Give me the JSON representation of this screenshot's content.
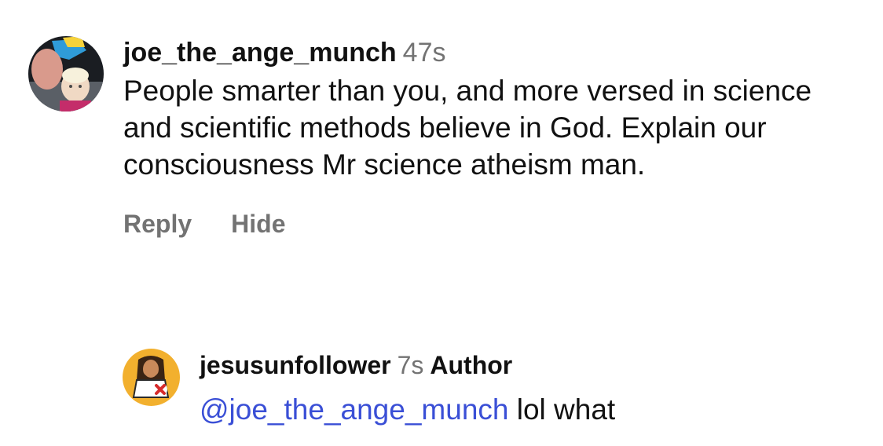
{
  "comment": {
    "username": "joe_the_ange_munch",
    "timestamp": "47s",
    "text": "People smarter than you, and more versed in science and scientific methods believe in God. Explain our consciousness Mr science atheism man.",
    "actions": {
      "reply_label": "Reply",
      "hide_label": "Hide"
    }
  },
  "reply": {
    "username": "jesusunfollower",
    "timestamp": "7s",
    "badge": "Author",
    "mention": "@joe_the_ange_munch",
    "text": " lol what"
  },
  "colors": {
    "secondary_text": "#737373",
    "mention_link": "#3a4fd6",
    "reply_avatar_bg": "#f2b02e"
  }
}
